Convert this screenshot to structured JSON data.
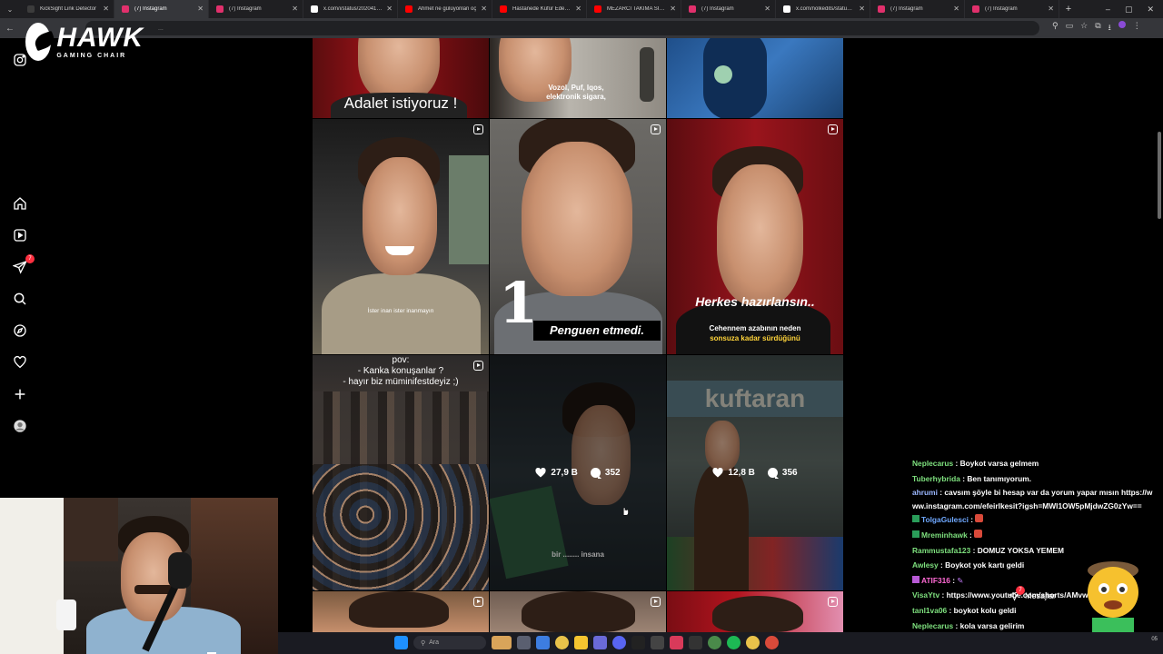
{
  "browser": {
    "tabs": [
      {
        "label": "KickSight Link Detector",
        "favicon_color": "#3c3c3c",
        "active": false
      },
      {
        "label": "(7) Instagram",
        "favicon_color": "#e1306c",
        "active": true
      },
      {
        "label": "(7) Instagram",
        "favicon_color": "#e1306c",
        "active": false
      },
      {
        "label": "x.com/i/status/20204146...",
        "favicon_color": "#ffffff",
        "active": false
      },
      {
        "label": "Ahmet ne gülüyonlan oç",
        "favicon_color": "#ff0000",
        "active": false
      },
      {
        "label": "Hastanede Küfür Eden Ç...",
        "favicon_color": "#ff0000",
        "active": false
      },
      {
        "label": "MEZARCI TAKIMA SİNİRL...",
        "favicon_color": "#ff0000",
        "active": false
      },
      {
        "label": "(7) Instagram",
        "favicon_color": "#e1306c",
        "active": false
      },
      {
        "label": "x.com/nolkedits/status/...",
        "favicon_color": "#ffffff",
        "active": false
      },
      {
        "label": "(7) Instagram",
        "favicon_color": "#e1306c",
        "active": false
      },
      {
        "label": "(7) Instagram",
        "favicon_color": "#e1306c",
        "active": false
      }
    ],
    "url": "..."
  },
  "sponsor": {
    "word": "HAWK",
    "sub": "GAMING CHAIR"
  },
  "instagram": {
    "nav": [
      {
        "name": "instagram-logo-icon"
      },
      {
        "name": "home-icon"
      },
      {
        "name": "reels-icon"
      },
      {
        "name": "direct-messages-icon",
        "badge": "7"
      },
      {
        "name": "search-icon"
      },
      {
        "name": "explore-icon"
      },
      {
        "name": "notifications-heart-icon"
      },
      {
        "name": "create-plus-icon"
      },
      {
        "name": "profile-avatar-icon"
      }
    ],
    "posts": [
      {
        "caption": "Adalet istiyoruz !"
      },
      {
        "caption": "Vozol, Puf, Iqos, elektronik sigara,"
      },
      {
        "caption": ""
      },
      {
        "caption": "İster inan ister inanmayın"
      },
      {
        "caption_big": "1",
        "caption": "Penguen etmedi."
      },
      {
        "caption": "Herkes hazırlansın..",
        "caption_sub1": "Cehennem azabının neden",
        "caption_sub2": "sonsuza kadar sürdüğünü"
      },
      {
        "caption": "pov:",
        "caption_sub1": "- Kanka konuşanlar ?",
        "caption_sub2": "- hayır biz müminifestdeyiz ;)"
      },
      {
        "caption": "bir ........ insana",
        "likes": "27,9 B",
        "comments": "352"
      },
      {
        "caption": "kuftaran",
        "likes": "12,8 B",
        "comments": "356"
      }
    ]
  },
  "chat": [
    {
      "user": "Neplecarus",
      "color": "#7ee07e",
      "text": " : Boykot varsa gelmem"
    },
    {
      "user": "Tuberhybrida",
      "color": "#7ee07e",
      "text": " : Ben tanımıyorum."
    },
    {
      "user": "ahrumi",
      "color": "#9bb7ff",
      "text": " : cavsım şöyle bi hesap var da yorum yapar mısın https://www.instagram.com/efeirlkesit?igsh=MWI1OW5pMjdwZG0zYw=="
    },
    {
      "user": "TolgaGulesci",
      "color": "#6fa8ff",
      "text": " : "
    },
    {
      "user": "Mreminhawk",
      "color": "#7ee07e",
      "text": " : "
    },
    {
      "user": "Rammustafa123",
      "color": "#7ee07e",
      "text": " : DOMUZ YOKSA YEMEM"
    },
    {
      "user": "Awlesy",
      "color": "#7ee07e",
      "text": " : Boykot yok kartı geldi"
    },
    {
      "user": "ATIF316",
      "color": "#ff6ad5",
      "text": " : "
    },
    {
      "user": "VisaYtv",
      "color": "#7ee07e",
      "text": " : https://www.youtube.com/shorts/AMvwZEBIlES"
    },
    {
      "user": "tanl1va06",
      "color": "#7ee07e",
      "text": " : boykot kolu geldi"
    },
    {
      "user": "Neplecarus",
      "color": "#7ee07e",
      "text": " : kola varsa gelirim"
    }
  ],
  "messages_widget": {
    "label": "Mesajlar",
    "badge": "7"
  },
  "taskbar": {
    "search_placeholder": "Ara",
    "clock": "05"
  }
}
